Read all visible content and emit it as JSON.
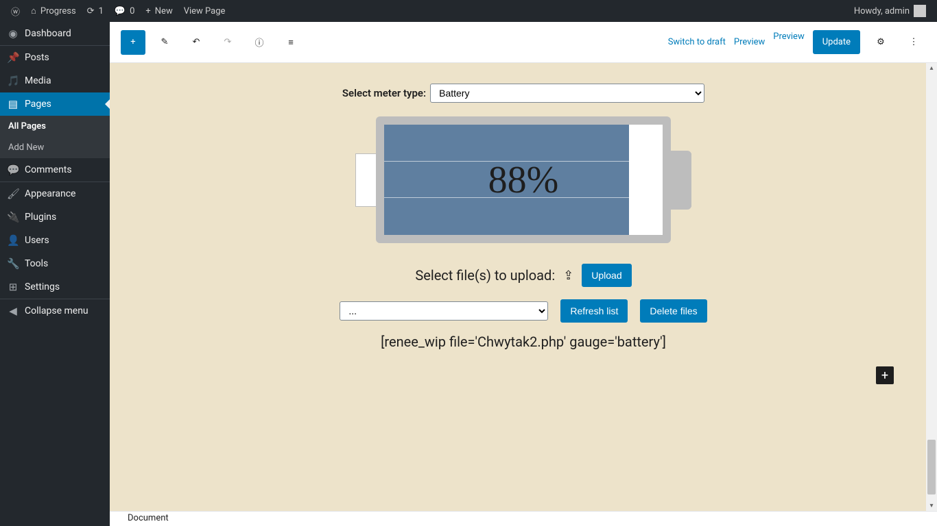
{
  "adminbar": {
    "site_title": "Progress",
    "refresh_count": "1",
    "comment_count": "0",
    "new_label": "New",
    "view_page": "View Page",
    "howdy": "Howdy, admin"
  },
  "sidebar": {
    "dashboard": "Dashboard",
    "posts": "Posts",
    "media": "Media",
    "pages": "Pages",
    "all_pages": "All Pages",
    "add_new": "Add New",
    "comments": "Comments",
    "appearance": "Appearance",
    "plugins": "Plugins",
    "users": "Users",
    "tools": "Tools",
    "settings": "Settings",
    "collapse": "Collapse menu"
  },
  "header": {
    "switch_to_draft": "Switch to draft",
    "preview": "Preview",
    "preview2": "Preview",
    "update": "Update"
  },
  "editor": {
    "select_meter_label": "Select meter type:",
    "meter_value": "Battery",
    "battery_percent": "88%",
    "upload_label": "Select file(s) to upload:",
    "upload_btn": "Upload",
    "file_selected": "...",
    "refresh_btn": "Refresh list",
    "delete_btn": "Delete files",
    "shortcode": "[renee_wip file='Chwytak2.php' gauge='battery']"
  },
  "footer": {
    "crumb": "Document"
  }
}
